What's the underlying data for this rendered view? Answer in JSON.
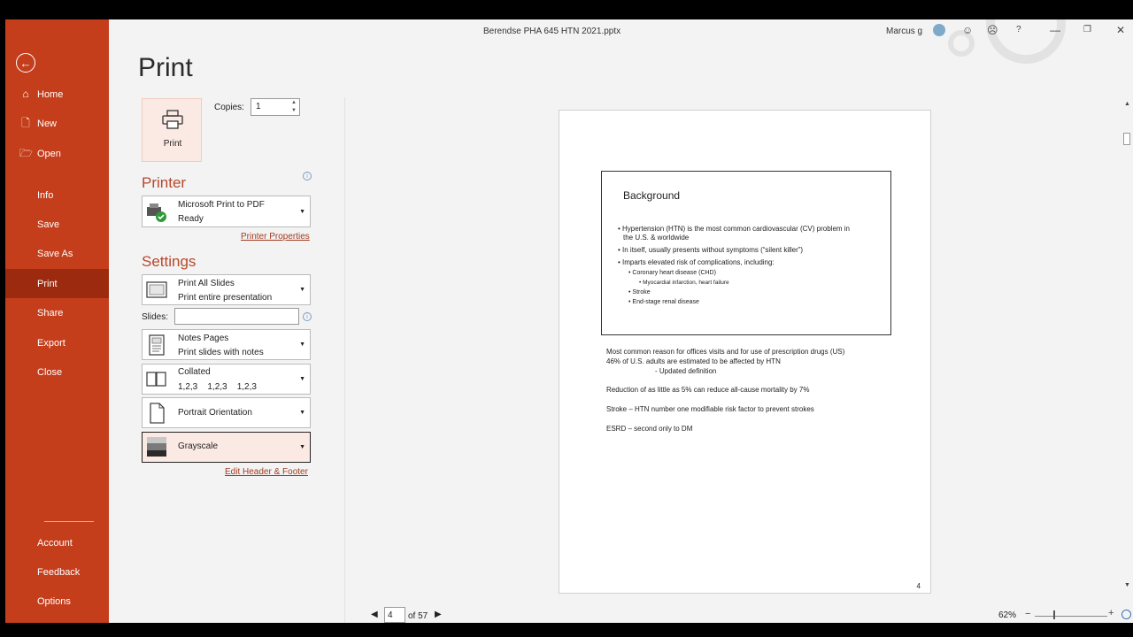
{
  "window": {
    "title": "Berendse PHA 645 HTN 2021.pptx",
    "user": "Marcus g"
  },
  "sidebar": {
    "items": [
      {
        "label": "Home",
        "icon": "home-icon"
      },
      {
        "label": "New",
        "icon": "new-doc-icon"
      },
      {
        "label": "Open",
        "icon": "folder-open-icon"
      },
      {
        "label": "Info"
      },
      {
        "label": "Save"
      },
      {
        "label": "Save As"
      },
      {
        "label": "Print"
      },
      {
        "label": "Share"
      },
      {
        "label": "Export"
      },
      {
        "label": "Close"
      }
    ],
    "bottom_items": [
      {
        "label": "Account"
      },
      {
        "label": "Feedback"
      },
      {
        "label": "Options"
      }
    ],
    "active": "Print",
    "accent": "#c43e1c"
  },
  "print": {
    "heading": "Print",
    "button_label": "Print",
    "copies_label": "Copies:",
    "copies_value": "1"
  },
  "printer": {
    "section_title": "Printer",
    "name": "Microsoft Print to PDF",
    "status": "Ready",
    "properties_link": "Printer Properties"
  },
  "settings": {
    "section_title": "Settings",
    "slides_range": {
      "title": "Print All Slides",
      "subtitle": "Print entire presentation"
    },
    "slides_label": "Slides:",
    "slides_value": "",
    "layout": {
      "title": "Notes Pages",
      "subtitle": "Print slides with notes"
    },
    "collation": {
      "title": "Collated",
      "subtitle": "1,2,3    1,2,3    1,2,3"
    },
    "orientation": {
      "title": "Portrait Orientation"
    },
    "color": {
      "title": "Grayscale"
    },
    "header_footer_link": "Edit Header & Footer"
  },
  "preview": {
    "slide_title": "Background",
    "bullets": [
      "Hypertension (HTN) is the most common cardiovascular (CV) problem in",
      "the U.S. & worldwide",
      "In itself, usually presents without symptoms (“silent killer”)",
      "Imparts elevated risk of complications, including:",
      "Coronary heart disease (CHD)",
      "Myocardial infarction, heart failure",
      "Stroke",
      "End-stage renal disease"
    ],
    "notes": [
      "Most common reason for offices visits and for use of prescription drugs (US)",
      "46% of U.S. adults are estimated to be affected by HTN",
      "- Updated definition",
      "Reduction of as little as 5% can reduce all-cause mortality by 7%",
      "Stroke – HTN number one modifiable risk factor to prevent strokes",
      "ESRD – second only to DM"
    ],
    "page_number": "4"
  },
  "navigation": {
    "current_page": "4",
    "of_label": "of 57"
  },
  "zoom": {
    "level": "62%",
    "fraction": 0.25
  }
}
